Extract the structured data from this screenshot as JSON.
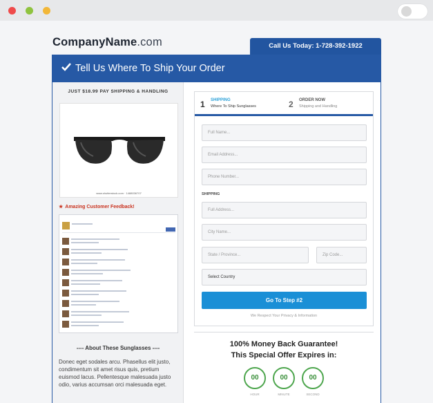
{
  "window": {
    "controls": [
      "close",
      "minimize",
      "maximize"
    ]
  },
  "header": {
    "logo_bold": "CompanyName",
    "logo_light": ".com",
    "call_text": "Call Us Today: 1-728-392-1922"
  },
  "banner": {
    "title": "Tell Us Where To Ship Your Order",
    "icon": "check-icon"
  },
  "left": {
    "price_line": "JUST $18.99 PAY SHIPPING & HANDLING",
    "image_caption": "www.shutterstock.com · 1488036707",
    "feedback_title": "Amazing Customer Feedback!",
    "about_title": "---- About These Sunglasses ----",
    "about_text": "Donec eget sodales arcu. Phasellus elit justo, condimentum sit amet risus quis, pretium euismod lacus. Pellentesque malesuada justo odio, varius accumsan orci malesuada eget."
  },
  "steps": [
    {
      "num": "1",
      "title": "SHIPPING",
      "subtitle": "Where To Ship Sunglasses"
    },
    {
      "num": "2",
      "title": "ORDER NOW",
      "subtitle": "Shipping and Handling"
    }
  ],
  "form": {
    "full_name": "Full Name...",
    "email": "Email Address...",
    "phone": "Phone Number...",
    "shipping_label": "SHIPPING",
    "address": "Full Address...",
    "city": "City Name...",
    "state": "State / Province...",
    "zip": "Zip Code...",
    "country": "Select Country",
    "submit": "Go To Step #2",
    "privacy": "We Respect Your Privacy & Information"
  },
  "guarantee": {
    "line1": "100% Money Back Guarantee!",
    "line2": "This Special Offer Expires in:",
    "timer": [
      {
        "value": "00",
        "label": "HOUR"
      },
      {
        "value": "00",
        "label": "MINUTE"
      },
      {
        "value": "00",
        "label": "SECOND"
      }
    ]
  }
}
